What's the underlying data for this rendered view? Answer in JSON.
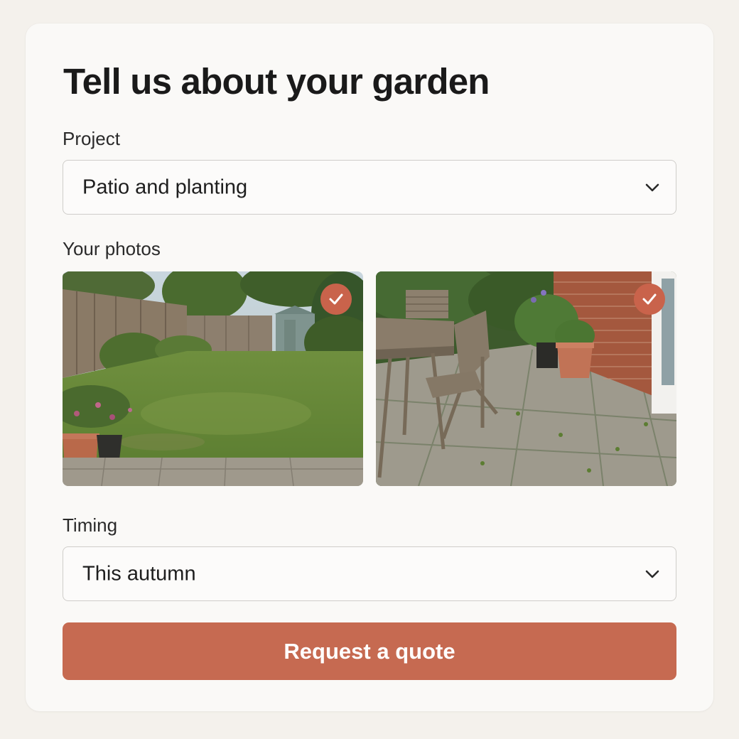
{
  "form": {
    "title": "Tell us about your garden",
    "project": {
      "label": "Project",
      "value": "Patio and planting"
    },
    "photos": {
      "label": "Your photos",
      "items": [
        {
          "scene": "lawn garden with fence and shed",
          "selected": true
        },
        {
          "scene": "stone patio with wooden table and chairs",
          "selected": true
        }
      ]
    },
    "timing": {
      "label": "Timing",
      "value": "This autumn"
    },
    "submit_label": "Request a quote"
  },
  "colors": {
    "accent": "#c66a51",
    "check_badge": "#c9634b",
    "card_background": "#faf9f7",
    "page_background": "#f4f1ec"
  },
  "icons": [
    "chevron-down-icon",
    "checkmark-icon"
  ]
}
